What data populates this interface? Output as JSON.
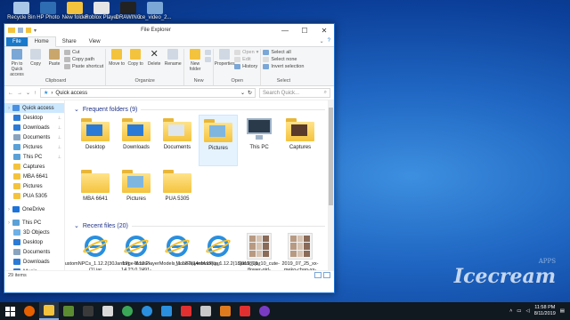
{
  "desktop_icons": [
    {
      "label": "Recycle Bin",
      "icon": "recycle-bin-icon",
      "color": "#a9c7e6"
    },
    {
      "label": "HP Photo",
      "icon": "hp-photo-icon",
      "color": "#2f6db3"
    },
    {
      "label": "New folder",
      "icon": "folder-icon",
      "color": "#f4c33d"
    },
    {
      "label": "Roblox Player",
      "icon": "roblox-icon",
      "color": "#e5e5e5"
    },
    {
      "label": "DRAWING",
      "icon": "drawing-icon",
      "color": "#222"
    },
    {
      "label": "ice_video_2...",
      "icon": "video-file-icon",
      "color": "#7aa7d6"
    }
  ],
  "window": {
    "title": "File Explorer",
    "tabs": [
      "File",
      "Home",
      "Share",
      "View"
    ],
    "ribbon": {
      "clipboard": {
        "label": "Clipboard",
        "pin": "Pin to Quick access",
        "copy": "Copy",
        "paste": "Paste",
        "cut": "Cut",
        "copy_path": "Copy path",
        "paste_shortcut": "Paste shortcut"
      },
      "organize": {
        "label": "Organize",
        "move_to": "Move to",
        "copy_to": "Copy to",
        "delete": "Delete",
        "rename": "Rename"
      },
      "new": {
        "label": "New",
        "new_folder": "New folder"
      },
      "open": {
        "label": "Open",
        "properties": "Properties",
        "open": "Open",
        "edit": "Edit",
        "history": "History"
      },
      "select": {
        "label": "Select",
        "select_all": "Select all",
        "select_none": "Select none",
        "invert": "Invert selection"
      }
    },
    "address": {
      "path": "Quick access",
      "search_placeholder": "Search Quick..."
    },
    "nav": [
      {
        "label": "Quick access",
        "level": 1,
        "selected": true,
        "color": "#4a90e2"
      },
      {
        "label": "Desktop",
        "level": 2,
        "pin": true,
        "color": "#2b7bd6"
      },
      {
        "label": "Downloads",
        "level": 2,
        "pin": true,
        "color": "#2b7bd6"
      },
      {
        "label": "Documents",
        "level": 2,
        "pin": true,
        "color": "#8aa4c0"
      },
      {
        "label": "Pictures",
        "level": 2,
        "pin": true,
        "color": "#5aa1d8"
      },
      {
        "label": "This PC",
        "level": 2,
        "pin": true,
        "color": "#5aa1d8"
      },
      {
        "label": "Captures",
        "level": 2,
        "color": "#f4c33d"
      },
      {
        "label": "MBA 6641",
        "level": 2,
        "color": "#f4c33d"
      },
      {
        "label": "Pictures",
        "level": 2,
        "color": "#f4c33d"
      },
      {
        "label": "PUA 5305",
        "level": 2,
        "color": "#f4c33d"
      },
      {
        "label": "OneDrive",
        "level": 1,
        "gap": true,
        "color": "#1e73d9"
      },
      {
        "label": "This PC",
        "level": 1,
        "gap": true,
        "color": "#5aa1d8"
      },
      {
        "label": "3D Objects",
        "level": 2,
        "color": "#6fb1e6"
      },
      {
        "label": "Desktop",
        "level": 2,
        "color": "#2b7bd6"
      },
      {
        "label": "Documents",
        "level": 2,
        "color": "#8aa4c0"
      },
      {
        "label": "Downloads",
        "level": 2,
        "color": "#2b7bd6"
      },
      {
        "label": "Music",
        "level": 2,
        "color": "#2b7bd6"
      }
    ],
    "frequent_header": "Frequent folders (9)",
    "frequent": [
      {
        "label": "Desktop",
        "overlay": "#2b7bd6"
      },
      {
        "label": "Downloads",
        "overlay": "#2b7bd6"
      },
      {
        "label": "Documents",
        "overlay": "#dfe6ee"
      },
      {
        "label": "Pictures",
        "overlay": "#7fb6e0",
        "selected": true
      },
      {
        "label": "This PC",
        "pc": true
      },
      {
        "label": "Captures",
        "overlay": "#5a3a2a"
      },
      {
        "label": "MBA 6641",
        "overlay": ""
      },
      {
        "label": "Pictures",
        "overlay": "#7fb6e0",
        "open": true
      },
      {
        "label": "PUA 5305",
        "overlay": ""
      }
    ],
    "recent_header": "Recent files (20)",
    "recent": [
      {
        "label": "CustomNPCs_1.12.2(30Jan19)(1).jar",
        "kind": "ie"
      },
      {
        "label": "forge-1.12.2-14.23.0.2491-installer.jar",
        "kind": "ie"
      },
      {
        "label": "MorePlayerModels_1.12.2(14nov17).jar",
        "kind": "ie"
      },
      {
        "label": "MorePlayerModels_1.12.2(18jan18).jar",
        "kind": "ie"
      },
      {
        "label": "2019_08_10_cute-flower-girl-13315707.png",
        "kind": "thumb"
      },
      {
        "label": "2019_07_25_xx-meko-chan-xx-13239353.png",
        "kind": "thumb"
      }
    ],
    "status": "29 items"
  },
  "taskbar": {
    "apps": [
      {
        "icon": "start-icon",
        "color": "#ffffff"
      },
      {
        "icon": "firefox-icon",
        "color": "#e66000"
      },
      {
        "icon": "file-explorer-icon",
        "color": "#f4c33d",
        "active": true
      },
      {
        "icon": "minecraft-icon",
        "color": "#5b8c32"
      },
      {
        "icon": "app-icon",
        "color": "#3a3a3a"
      },
      {
        "icon": "roblox-icon",
        "color": "#d9d9d9"
      },
      {
        "icon": "chrome-icon",
        "color": "#3aa757"
      },
      {
        "icon": "ie-icon",
        "color": "#2a8fde"
      },
      {
        "icon": "store-icon",
        "color": "#2a8fde"
      },
      {
        "icon": "roblox-studio-icon",
        "color": "#e23030"
      },
      {
        "icon": "mail-icon",
        "color": "#c8c8c8"
      },
      {
        "icon": "app-icon",
        "color": "#e07a1f"
      },
      {
        "icon": "camera-icon",
        "color": "#e23030"
      },
      {
        "icon": "firefox-icon",
        "color": "#7a3bc4"
      }
    ],
    "time": "11:58 PM",
    "date": "8/11/2019"
  },
  "watermark": {
    "brand": "Icecream",
    "sub": "APPS"
  }
}
